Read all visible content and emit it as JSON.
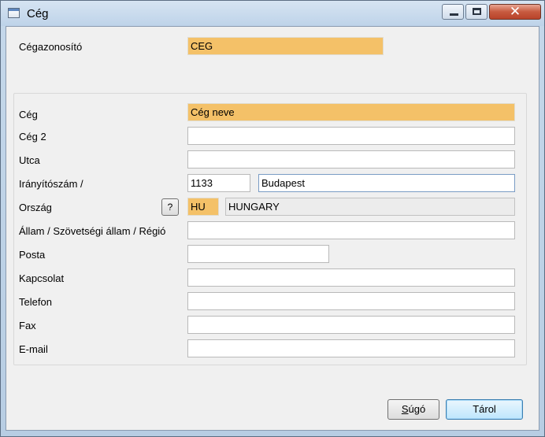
{
  "window": {
    "title": "Cég",
    "close_glyph": "✕",
    "icons": [
      "app-window-icon",
      "minimize-icon",
      "maximize-icon",
      "close-icon"
    ]
  },
  "header": {
    "id_label": "Cégazonosító",
    "id_value": "CEG"
  },
  "form": {
    "company_label": "Cég",
    "company_value": "Cég neve",
    "company2_label": "Cég 2",
    "company2_value": "",
    "street_label": "Utca",
    "street_value": "",
    "zip_label": "Irányítószám /",
    "zip_value": "1133",
    "city_value": "Budapest",
    "country_label": "Ország",
    "country_lookup_label": "?",
    "country_code": "HU",
    "country_name": "HUNGARY",
    "state_label": "Állam / Szövetségi állam / Régió",
    "state_value": "",
    "post_label": "Posta",
    "post_value": "",
    "contact_label": "Kapcsolat",
    "contact_value": "",
    "phone_label": "Telefon",
    "phone_value": "",
    "fax_label": "Fax",
    "fax_value": "",
    "email_label": "E-mail",
    "email_value": ""
  },
  "buttons": {
    "help_mnemonic": "S",
    "help_rest": "úgó",
    "save_label": "Tárol"
  },
  "colors": {
    "required_field": "#f4c168",
    "readonly_field": "#ececec",
    "client_background": "#f0f0f0",
    "close_button": "#c75a3f"
  }
}
